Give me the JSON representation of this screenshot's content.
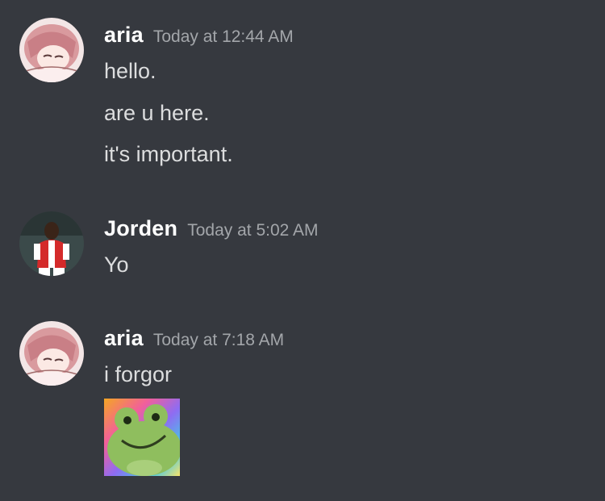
{
  "messages": [
    {
      "author": "aria",
      "timestamp": "Today at 12:44 AM",
      "avatar_icon": "anime-girl-avatar",
      "lines": [
        "hello.",
        "are u here.",
        "it's important."
      ]
    },
    {
      "author": "Jorden",
      "timestamp": "Today at 5:02 AM",
      "avatar_icon": "footballer-avatar",
      "lines": [
        "Yo"
      ]
    },
    {
      "author": "aria",
      "timestamp": "Today at 7:18 AM",
      "avatar_icon": "anime-girl-avatar",
      "lines": [
        "i forgor"
      ],
      "attachment": "frog-sticker"
    }
  ],
  "colors": {
    "background": "#36393f",
    "username": "#ffffff",
    "timestamp": "#a3a6aa",
    "message_text": "#dcddde"
  }
}
